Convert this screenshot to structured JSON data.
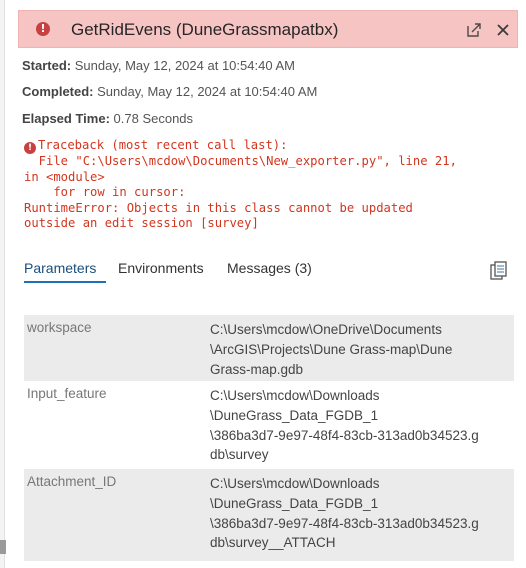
{
  "header": {
    "title": "GetRidEvens (DuneGrassmapatbx)",
    "status_icon": "error-icon",
    "popout_icon": "popout-icon",
    "close_icon": "close-icon"
  },
  "meta": {
    "started_label": "Started:",
    "started_value": "Sunday, May 12, 2024 at 10:54:40 AM",
    "completed_label": "Completed:",
    "completed_value": "Sunday, May 12, 2024 at 10:54:40 AM",
    "elapsed_label": "Elapsed Time:",
    "elapsed_value": "0.78 Seconds"
  },
  "traceback": {
    "icon": "error-icon",
    "lines": [
      "Traceback (most recent call last):",
      "  File \"C:\\Users\\mcdow\\Documents\\New_exporter.py\", line 21,",
      "in <module>",
      "    for row in cursor:",
      "RuntimeError: Objects in this class cannot be updated",
      "outside an edit session [survey]"
    ]
  },
  "tabs": [
    {
      "label": "Parameters",
      "active": true
    },
    {
      "label": "Environments",
      "active": false
    },
    {
      "label": "Messages (3)",
      "active": false
    }
  ],
  "copy_icon": "copy-icon",
  "parameters": [
    {
      "name": "workspace",
      "value_lines": [
        "C:\\Users\\mcdow\\OneDrive\\Documents",
        "\\ArcGIS\\Projects\\Dune Grass-map\\Dune",
        "Grass-map.gdb"
      ]
    },
    {
      "name": "Input_feature",
      "value_lines": [
        "C:\\Users\\mcdow\\Downloads",
        "\\DuneGrass_Data_FGDB_1",
        "\\386ba3d7-9e97-48f4-83cb-313ad0b34523.g",
        "db\\survey"
      ]
    },
    {
      "name": "Attachment_ID",
      "value_lines": [
        "C:\\Users\\mcdow\\Downloads",
        "\\DuneGrass_Data_FGDB_1",
        "\\386ba3d7-9e97-48f4-83cb-313ad0b34523.g",
        "db\\survey__ATTACH"
      ]
    }
  ]
}
